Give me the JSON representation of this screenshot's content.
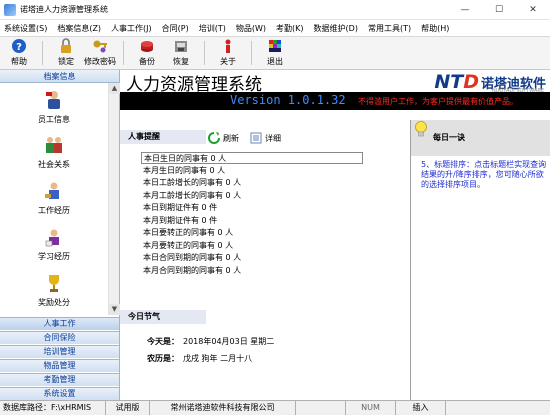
{
  "window": {
    "title": "诺塔迪人力资源管理系统",
    "min": "—",
    "max": "☐",
    "close": "✕"
  },
  "menu": [
    "系统设置(S)",
    "档案信息(Z)",
    "人事工作(J)",
    "合同(P)",
    "培训(T)",
    "物品(W)",
    "考勤(K)",
    "数据维护(D)",
    "常用工具(T)",
    "帮助(H)"
  ],
  "toolbar": {
    "help": "帮助",
    "lock": "锁定",
    "change_password": "修改密码",
    "backup": "备份",
    "restore": "恢复",
    "about": "关于",
    "exit": "退出"
  },
  "sidebar": {
    "header": "档案信息",
    "items": [
      "员工信息",
      "社会关系",
      "工作经历",
      "学习经历",
      "奖励处分"
    ],
    "tabs": [
      "人事工作",
      "合同保险",
      "培训管理",
      "物品管理",
      "考勤管理",
      "系统设置"
    ]
  },
  "banner": {
    "system_name": "人力资源管理系统",
    "logo_ntd": "NT",
    "logo_d": "D",
    "logo_cn": "诺塔迪软件",
    "logo_en": "NUOTADI SOFTWARE",
    "version": "Version 1.0.1.32",
    "notice": "不得滥用户工作，为客户提供最有价值产品。"
  },
  "reminders": {
    "title": "人事提醒",
    "refresh": "刷新",
    "detail": "详细",
    "items": [
      "本日生日的同事有 0 人",
      "本月生日的同事有 0 人",
      "本日工龄增长的同事有 0 人",
      "本月工龄增长的同事有 0 人",
      "本日到期证件有 0 件",
      "本月到期证件有 0 件",
      "本日要转正的同事有 0 人",
      "本月要转正的同事有 0 人",
      "本日合同到期的同事有 0 人",
      "本月合同到期的同事有 0 人"
    ]
  },
  "festival": {
    "title": "今日节气",
    "today_label": "今天是：",
    "today_value": "2018年04月03日  星期二",
    "lunar_label": "农历是：",
    "lunar_value": "戊戌 狗年  二月十八"
  },
  "tip": {
    "title": "每日一诀",
    "body": "5、标题排序：点击标题栏实现查询结果的升/降序排序，您可随心所欲的选择排序项目。"
  },
  "status": {
    "db_path": "数据库路径：F:\\xHRMIS",
    "edition": "试用版",
    "company": "常州诺塔迪软件科技有限公司",
    "caps": "",
    "num": "NUM",
    "insert": "插入",
    "empty": ""
  }
}
